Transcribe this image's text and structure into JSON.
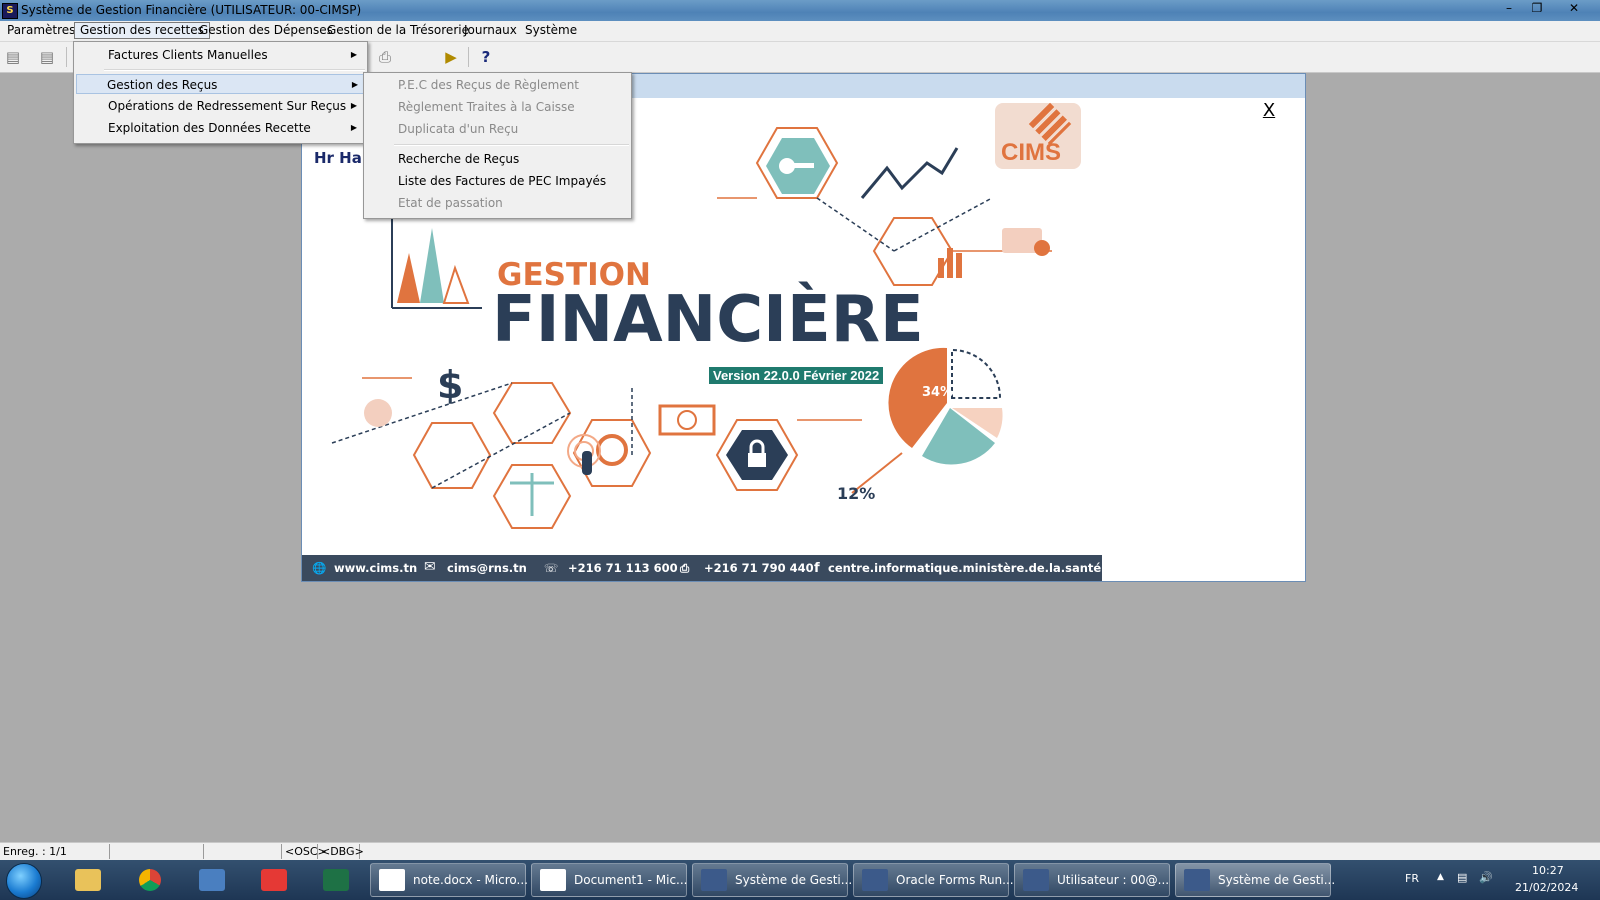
{
  "window": {
    "title": "Système de Gestion Financière (UTILISATEUR: 00-CIMSP)"
  },
  "menubar": {
    "items": [
      "Paramètres",
      "Gestion des recettes",
      "Gestion des Dépenses",
      "Gestion de la Trésorerie",
      "Journaux",
      "Système"
    ]
  },
  "menu_recettes": {
    "items": [
      {
        "label": "Factures Clients Manuelles"
      },
      {
        "label": "Gestion des Reçus"
      },
      {
        "label": "Opérations de Redressement Sur Reçus"
      },
      {
        "label": "Exploitation des Données Recette"
      }
    ]
  },
  "submenu_recus": {
    "items": [
      {
        "label": "P.E.C des Reçus de Règlement",
        "enabled": false
      },
      {
        "label": "Règlement Traites à la Caisse",
        "enabled": false
      },
      {
        "label": "Duplicata d'un Reçu",
        "enabled": false
      },
      {
        "label": "Recherche de Reçus",
        "enabled": true
      },
      {
        "label": "Liste des Factures de PEC Impayés",
        "enabled": true
      },
      {
        "label": "Etat de passation",
        "enabled": false
      }
    ]
  },
  "child_window": {
    "close_label": "X",
    "greeting": "Hr Hab"
  },
  "splash": {
    "logo_text": "CIMS",
    "heading_small": "GESTION",
    "heading_large": "FINANCIÈRE",
    "version": "Version 22.0.0 Février 2022",
    "pie_labels": [
      "34%",
      "12%"
    ],
    "footer": {
      "website": "www.cims.tn",
      "email": "cims@rns.tn",
      "phone": "+216 71 113 600",
      "fax": "+216 71 790 440",
      "facebook": "centre.informatique.ministère.de.la.santé"
    }
  },
  "statusbar": {
    "record": "Enreg. : 1/1",
    "osc": "<OSC>",
    "dbg": "<DBG>"
  },
  "taskbar": {
    "tasks": [
      {
        "label": "note.docx - Micro...",
        "icon": "word-icon"
      },
      {
        "label": "Document1 - Mic...",
        "icon": "word-icon"
      },
      {
        "label": "Système de Gesti...",
        "icon": "oracle-forms-icon"
      },
      {
        "label": "Oracle Forms Run...",
        "icon": "oracle-forms-icon"
      },
      {
        "label": "Utilisateur : 00@...",
        "icon": "oracle-forms-icon"
      },
      {
        "label": "Système de Gesti...",
        "icon": "oracle-forms-icon"
      }
    ],
    "language": "FR",
    "time": "10:27",
    "date": "21/02/2024"
  },
  "colors": {
    "accent_orange": "#e0743f",
    "teal": "#7fbfbb",
    "navy": "#2b3e57",
    "version_bg": "#1f7a6e"
  }
}
